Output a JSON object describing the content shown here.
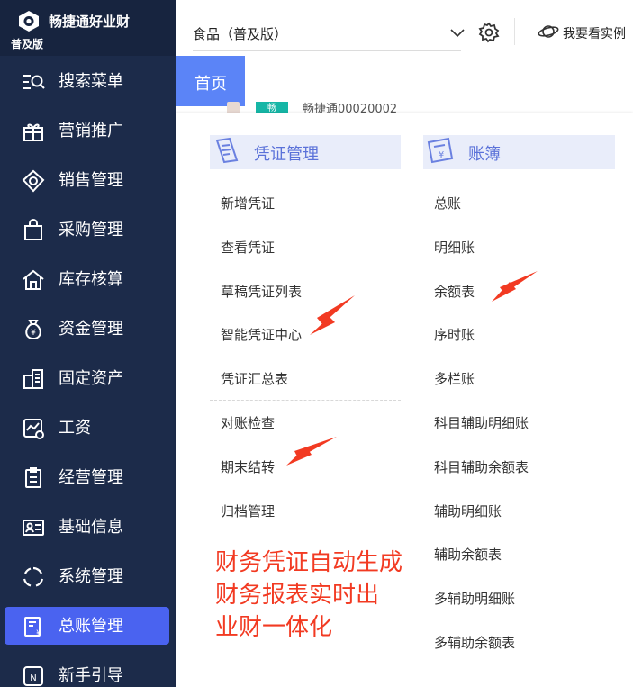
{
  "app": {
    "name": "畅捷通好业财",
    "edition": "普及版"
  },
  "colors": {
    "sidebar": "#1c2b4a",
    "accent": "#4a63f0",
    "tab": "#5b84f7",
    "section_head_bg": "#e9edfa",
    "section_head_text": "#5b72d9",
    "annotation": "#f23a22"
  },
  "sidebar": {
    "items": [
      {
        "label": "搜索菜单",
        "icon": "search-menu-icon"
      },
      {
        "label": "营销推广",
        "icon": "gift-icon"
      },
      {
        "label": "销售管理",
        "icon": "sales-icon"
      },
      {
        "label": "采购管理",
        "icon": "shopping-bag-icon"
      },
      {
        "label": "库存核算",
        "icon": "warehouse-icon"
      },
      {
        "label": "资金管理",
        "icon": "money-bag-icon"
      },
      {
        "label": "固定资产",
        "icon": "building-icon"
      },
      {
        "label": "工资",
        "icon": "salary-chart-icon"
      },
      {
        "label": "经营管理",
        "icon": "clipboard-icon"
      },
      {
        "label": "基础信息",
        "icon": "id-card-icon"
      },
      {
        "label": "系统管理",
        "icon": "system-icon"
      },
      {
        "label": "总账管理",
        "icon": "ledger-icon",
        "active": true
      },
      {
        "label": "新手引导",
        "icon": "new-badge-icon"
      }
    ]
  },
  "topbar": {
    "account_set": "食品（普及版）",
    "example_link": "我要看实例"
  },
  "tabs": {
    "home": "首页"
  },
  "background_row": {
    "badge": "畅",
    "text": "畅捷通00020002"
  },
  "voucher_section": {
    "title": "凭证管理",
    "items": [
      "新增凭证",
      "查看凭证",
      "草稿凭证列表",
      "智能凭证中心",
      "凭证汇总表"
    ],
    "items_after_separator": [
      "对账检查",
      "期末结转",
      "归档管理"
    ]
  },
  "ledger_section": {
    "title": "账簿",
    "items": [
      "总账",
      "明细账",
      "余额表",
      "序时账",
      "多栏账",
      "科目辅助明细账",
      "科目辅助余额表",
      "辅助明细账",
      "辅助余额表",
      "多辅助明细账",
      "多辅助余额表"
    ]
  },
  "annotation": {
    "lines": [
      "财务凭证自动生成",
      "财务报表实时出",
      "业财一体化"
    ]
  }
}
